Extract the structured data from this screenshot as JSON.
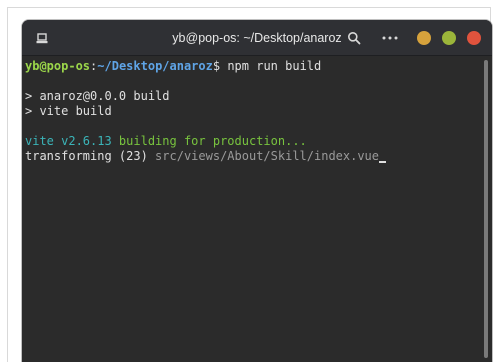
{
  "window": {
    "title": "yb@pop-os: ~/Desktop/anaroz",
    "buttons": {
      "minimize_color": "#d6a23c",
      "maximize_color": "#9bb53a",
      "close_color": "#e0533d"
    }
  },
  "terminal": {
    "prompt": {
      "user_host": "yb@pop-os",
      "separator": ":",
      "path": "~/Desktop/anaroz",
      "symbol": "$",
      "command": " npm run build"
    },
    "lines": {
      "script_name": "> anaroz@0.0.0 build",
      "script_cmd": "> vite build",
      "vite_version": "vite v2.6.13",
      "vite_status": " building for production...",
      "transform_label": "transforming (23) ",
      "transform_file": "src/views/About/Skill/index.vue"
    }
  },
  "icons": {
    "tab": "new-tab-icon",
    "search": "search-icon",
    "menu": "menu-dots-icon"
  }
}
